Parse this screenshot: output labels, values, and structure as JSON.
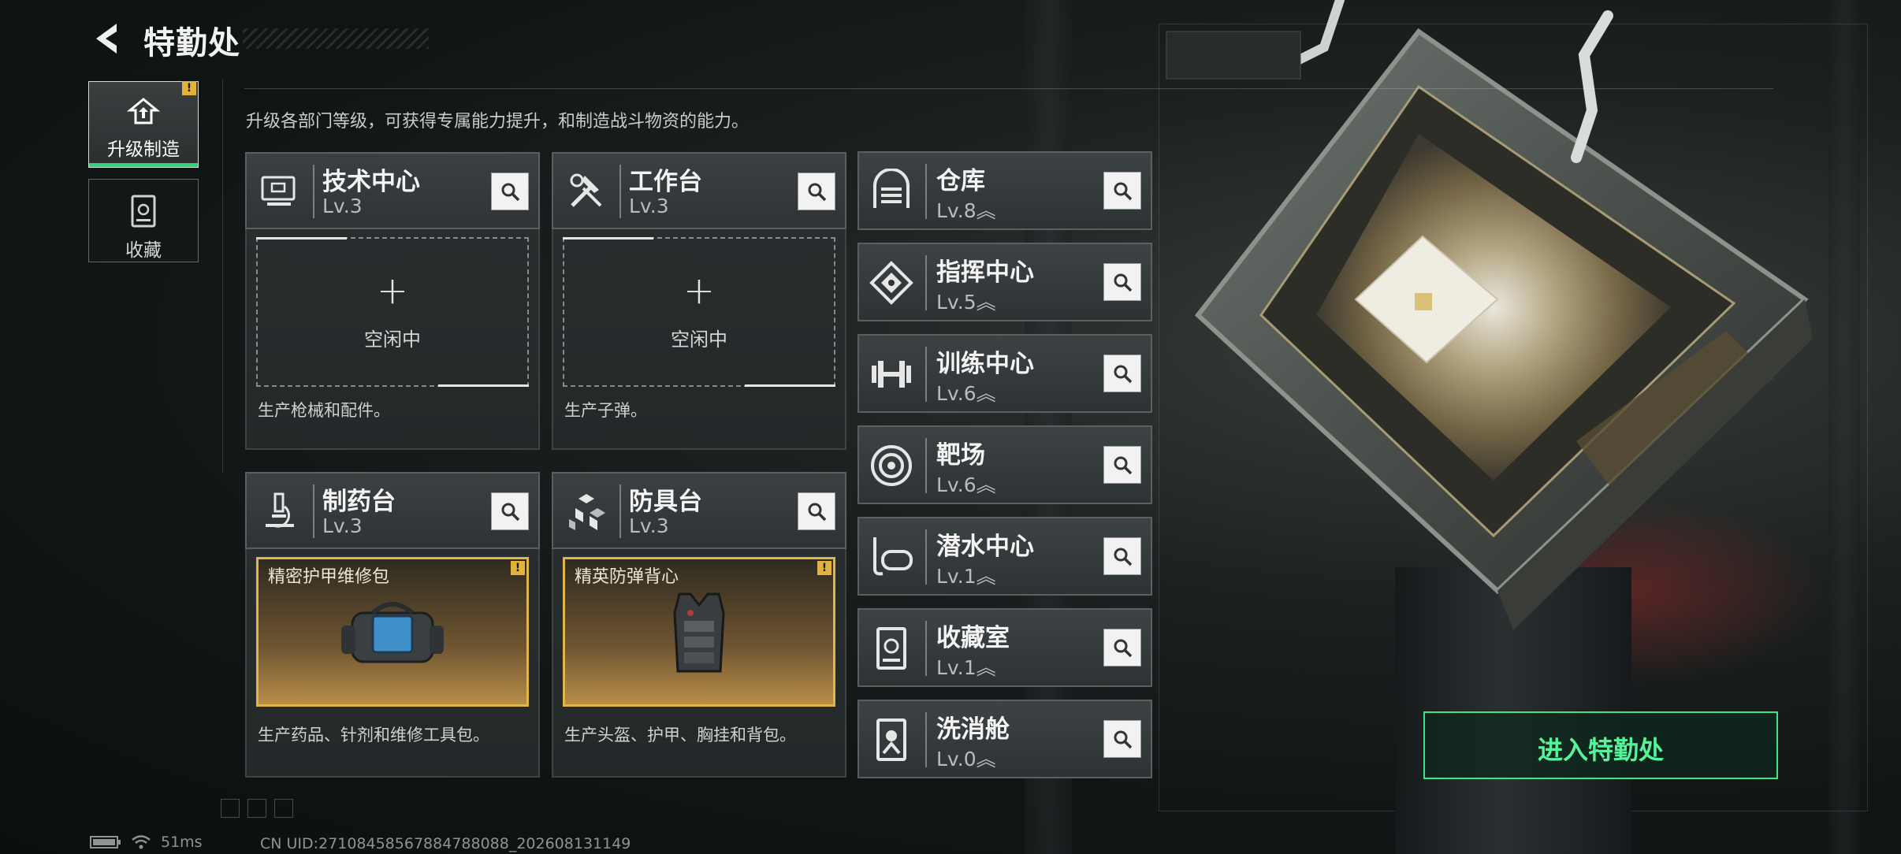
{
  "header": {
    "title": "特勤处"
  },
  "side_tabs": [
    {
      "label": "升级制造",
      "active": true,
      "has_alert": true,
      "alert_text": "!"
    },
    {
      "label": "收藏",
      "active": false
    }
  ],
  "description": "升级各部门等级，可获得专属能力提升，和制造战斗物资的能力。",
  "workshops": [
    {
      "name": "技术中心",
      "level": "Lv.3",
      "icon": "monitor-icon",
      "slot": {
        "state": "empty",
        "text": "空闲中"
      },
      "desc": "生产枪械和配件。"
    },
    {
      "name": "工作台",
      "level": "Lv.3",
      "icon": "tools-icon",
      "slot": {
        "state": "empty",
        "text": "空闲中"
      },
      "desc": "生产子弹。"
    },
    {
      "name": "制药台",
      "level": "Lv.3",
      "icon": "microscope-icon",
      "slot": {
        "state": "item",
        "item": "精密护甲维修包",
        "alert": "!"
      },
      "desc": "生产药品、针剂和维修工具包。"
    },
    {
      "name": "防具台",
      "level": "Lv.3",
      "icon": "cubes-icon",
      "slot": {
        "state": "item",
        "item": "精英防弹背心",
        "alert": "!"
      },
      "desc": "生产头盔、护甲、胸挂和背包。"
    }
  ],
  "facilities": [
    {
      "name": "仓库",
      "level": "Lv.8",
      "icon": "warehouse-icon",
      "upgradable": true
    },
    {
      "name": "指挥中心",
      "level": "Lv.5",
      "icon": "command-icon",
      "upgradable": true
    },
    {
      "name": "训练中心",
      "level": "Lv.6",
      "icon": "dumbbell-icon",
      "upgradable": true
    },
    {
      "name": "靶场",
      "level": "Lv.6",
      "icon": "target-icon",
      "upgradable": true
    },
    {
      "name": "潜水中心",
      "level": "Lv.1",
      "icon": "diving-mask-icon",
      "upgradable": true
    },
    {
      "name": "收藏室",
      "level": "Lv.1",
      "icon": "collection-icon",
      "upgradable": true
    },
    {
      "name": "洗消舱",
      "level": "Lv.0",
      "icon": "decontamination-icon",
      "upgradable": true
    }
  ],
  "enter_button": "进入特勤处",
  "status": {
    "ping": "51ms",
    "uid": "CN UID:27108458567884788088_202608131149"
  },
  "colors": {
    "accent_green": "#3ee38a",
    "alert_yellow": "#e2b23a",
    "level_chevron": "#e0b840"
  }
}
